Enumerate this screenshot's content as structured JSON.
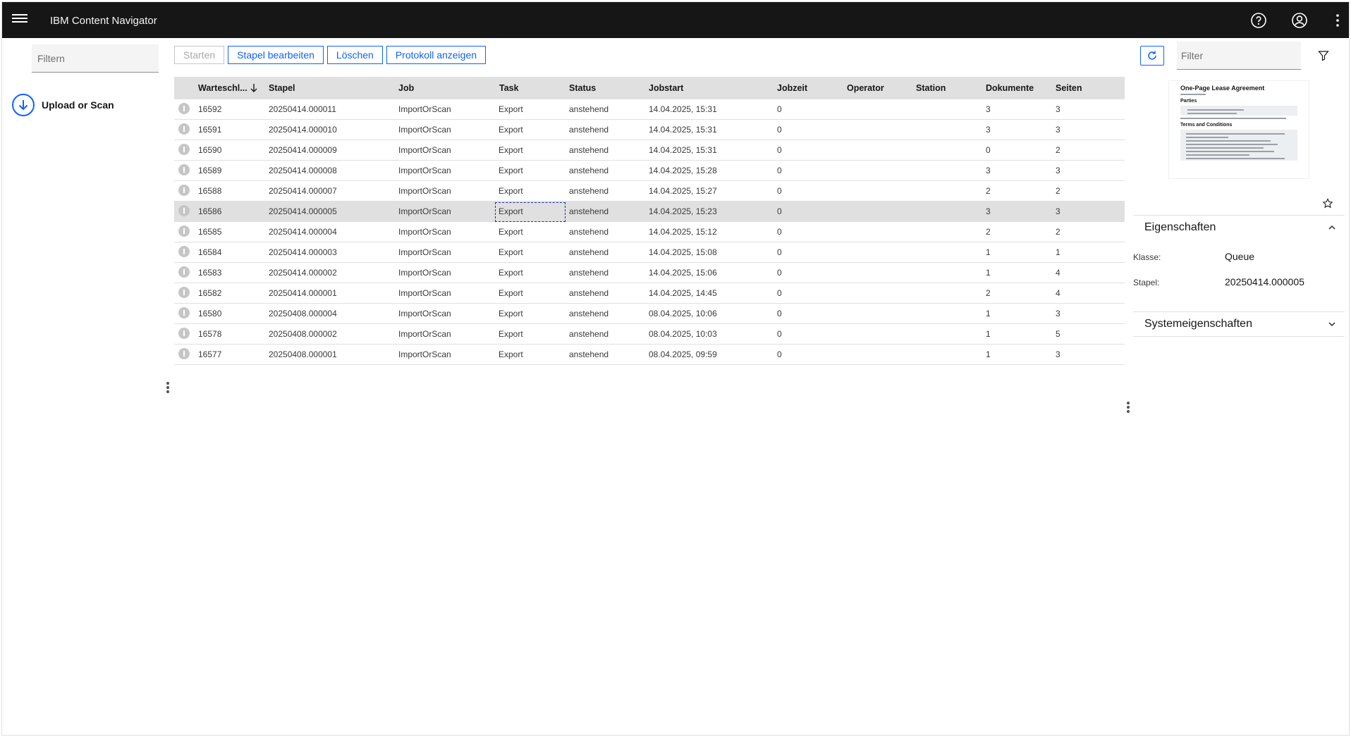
{
  "header": {
    "title": "IBM Content Navigator"
  },
  "sidebar": {
    "filter_placeholder": "Filtern",
    "upload_label": "Upload or Scan"
  },
  "toolbar": {
    "start_label": "Starten",
    "edit_batch_label": "Stapel bearbeiten",
    "delete_label": "Löschen",
    "show_log_label": "Protokoll anzeigen"
  },
  "grid": {
    "columns": [
      "Warteschl...",
      "Stapel",
      "Job",
      "Task",
      "Status",
      "Jobstart",
      "Jobzeit",
      "Operator",
      "Station",
      "Dokumente",
      "Seiten"
    ],
    "selected_index": 5,
    "rows": [
      {
        "id": "16592",
        "stapel": "20250414.000011",
        "job": "ImportOrScan",
        "task": "Export",
        "status": "anstehend",
        "jobstart": "14.04.2025, 15:31",
        "jobzeit": "0",
        "operator": "",
        "station": "",
        "dokumente": "3",
        "seiten": "3"
      },
      {
        "id": "16591",
        "stapel": "20250414.000010",
        "job": "ImportOrScan",
        "task": "Export",
        "status": "anstehend",
        "jobstart": "14.04.2025, 15:31",
        "jobzeit": "0",
        "operator": "",
        "station": "",
        "dokumente": "3",
        "seiten": "3"
      },
      {
        "id": "16590",
        "stapel": "20250414.000009",
        "job": "ImportOrScan",
        "task": "Export",
        "status": "anstehend",
        "jobstart": "14.04.2025, 15:31",
        "jobzeit": "0",
        "operator": "",
        "station": "",
        "dokumente": "0",
        "seiten": "2"
      },
      {
        "id": "16589",
        "stapel": "20250414.000008",
        "job": "ImportOrScan",
        "task": "Export",
        "status": "anstehend",
        "jobstart": "14.04.2025, 15:28",
        "jobzeit": "0",
        "operator": "",
        "station": "",
        "dokumente": "3",
        "seiten": "3"
      },
      {
        "id": "16588",
        "stapel": "20250414.000007",
        "job": "ImportOrScan",
        "task": "Export",
        "status": "anstehend",
        "jobstart": "14.04.2025, 15:27",
        "jobzeit": "0",
        "operator": "",
        "station": "",
        "dokumente": "2",
        "seiten": "2"
      },
      {
        "id": "16586",
        "stapel": "20250414.000005",
        "job": "ImportOrScan",
        "task": "Export",
        "status": "anstehend",
        "jobstart": "14.04.2025, 15:23",
        "jobzeit": "0",
        "operator": "",
        "station": "",
        "dokumente": "3",
        "seiten": "3"
      },
      {
        "id": "16585",
        "stapel": "20250414.000004",
        "job": "ImportOrScan",
        "task": "Export",
        "status": "anstehend",
        "jobstart": "14.04.2025, 15:12",
        "jobzeit": "0",
        "operator": "",
        "station": "",
        "dokumente": "2",
        "seiten": "2"
      },
      {
        "id": "16584",
        "stapel": "20250414.000003",
        "job": "ImportOrScan",
        "task": "Export",
        "status": "anstehend",
        "jobstart": "14.04.2025, 15:08",
        "jobzeit": "0",
        "operator": "",
        "station": "",
        "dokumente": "1",
        "seiten": "1"
      },
      {
        "id": "16583",
        "stapel": "20250414.000002",
        "job": "ImportOrScan",
        "task": "Export",
        "status": "anstehend",
        "jobstart": "14.04.2025, 15:06",
        "jobzeit": "0",
        "operator": "",
        "station": "",
        "dokumente": "1",
        "seiten": "4"
      },
      {
        "id": "16582",
        "stapel": "20250414.000001",
        "job": "ImportOrScan",
        "task": "Export",
        "status": "anstehend",
        "jobstart": "14.04.2025, 14:45",
        "jobzeit": "0",
        "operator": "",
        "station": "",
        "dokumente": "2",
        "seiten": "4"
      },
      {
        "id": "16580",
        "stapel": "20250408.000004",
        "job": "ImportOrScan",
        "task": "Export",
        "status": "anstehend",
        "jobstart": "08.04.2025, 10:06",
        "jobzeit": "0",
        "operator": "",
        "station": "",
        "dokumente": "1",
        "seiten": "3"
      },
      {
        "id": "16578",
        "stapel": "20250408.000002",
        "job": "ImportOrScan",
        "task": "Export",
        "status": "anstehend",
        "jobstart": "08.04.2025, 10:03",
        "jobzeit": "0",
        "operator": "",
        "station": "",
        "dokumente": "1",
        "seiten": "5"
      },
      {
        "id": "16577",
        "stapel": "20250408.000001",
        "job": "ImportOrScan",
        "task": "Export",
        "status": "anstehend",
        "jobstart": "08.04.2025, 09:59",
        "jobzeit": "0",
        "operator": "",
        "station": "",
        "dokumente": "1",
        "seiten": "3"
      }
    ]
  },
  "right_panel": {
    "filter_placeholder": "Filter",
    "preview": {
      "doc_title": "One-Page Lease Agreement",
      "section_parties": "Parties",
      "section_terms": "Terms and Conditions"
    },
    "properties": {
      "heading": "Eigenschaften",
      "class_label": "Klasse:",
      "class_value": "Queue",
      "batch_label": "Stapel:",
      "batch_value": "20250414.000005"
    },
    "system_properties": {
      "heading": "Systemeigenschaften"
    }
  },
  "colors": {
    "header_bg": "#161616",
    "accent": "#0f62fe",
    "selected_row": "#e0e0e0"
  }
}
